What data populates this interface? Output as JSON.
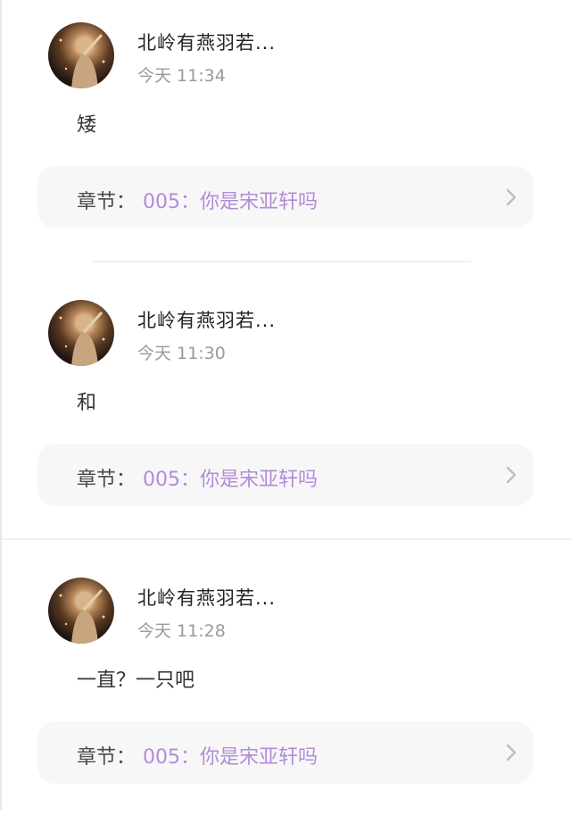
{
  "comments": [
    {
      "username": "北岭有燕羽若...",
      "time": "今天 11:34",
      "text": "矮",
      "chapter_label": "章节：",
      "chapter_title": "005：你是宋亚轩吗"
    },
    {
      "username": "北岭有燕羽若...",
      "time": "今天 11:30",
      "text": "和",
      "chapter_label": "章节：",
      "chapter_title": "005：你是宋亚轩吗"
    },
    {
      "username": "北岭有燕羽若...",
      "time": "今天 11:28",
      "text": "一直？一只吧",
      "chapter_label": "章节：",
      "chapter_title": "005：你是宋亚轩吗"
    }
  ],
  "colors": {
    "chapter_title": "#b38bd6",
    "card_background": "#f7f7f8",
    "username": "#222222",
    "timestamp": "#9a9a9a"
  },
  "icons": {
    "avatar": "user-avatar",
    "chevron": "chevron-right-icon"
  }
}
